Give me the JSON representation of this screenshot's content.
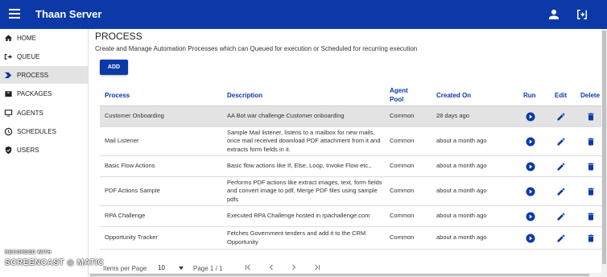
{
  "header": {
    "title": "Thaan Server",
    "user_icon": "person-icon",
    "logout_icon": "logout-icon"
  },
  "sidebar": {
    "items": [
      {
        "label": "HOME",
        "icon": "home-icon",
        "active": false
      },
      {
        "label": "QUEUE",
        "icon": "queue-icon",
        "active": false
      },
      {
        "label": "PROCESS",
        "icon": "process-icon",
        "active": true
      },
      {
        "label": "PACKAGES",
        "icon": "package-icon",
        "active": false
      },
      {
        "label": "AGENTS",
        "icon": "monitor-icon",
        "active": false
      },
      {
        "label": "SCHEDULES",
        "icon": "clock-icon",
        "active": false
      },
      {
        "label": "USERS",
        "icon": "shield-icon",
        "active": false
      }
    ]
  },
  "main": {
    "title": "PROCESS",
    "description": "Create and Manage Automation Processes which can Queued for execution or Scheduled for recurring execution",
    "add_label": "ADD"
  },
  "table": {
    "headers": {
      "process": "Process",
      "description": "Description",
      "agent_pool": "Agent Pool",
      "created_on": "Created On",
      "run": "Run",
      "edit": "Edit",
      "delete": "Delete"
    },
    "rows": [
      {
        "process": "Customer Onboarding",
        "description": "AA Bot war challenge Customer onboarding",
        "agent_pool": "Common",
        "created_on": "28 days ago"
      },
      {
        "process": "Mail Listener",
        "description": "Sample Mail listener, listens to a mailbox for new mails, once mail received download PDF attachment from it and extracts form fields in it.",
        "agent_pool": "Common",
        "created_on": "about a month ago"
      },
      {
        "process": "Basic Flow Actions",
        "description": "Basic flow actions like If, Else, Loop, Invoke Flow etc.,",
        "agent_pool": "Common",
        "created_on": "about a month ago"
      },
      {
        "process": "PDF Actions Sample",
        "description": "Performs PDF actions like extract images, text, form fields and convert image to pdf, Merge PDF files using sample pdfs",
        "agent_pool": "Common",
        "created_on": "about a month ago"
      },
      {
        "process": "RPA Challenge",
        "description": "Executed RPA Challenge hosted in rpachallenge.com",
        "agent_pool": "Common",
        "created_on": "about a month ago"
      },
      {
        "process": "Opportunity Tracker",
        "description": "Fetches Government tenders and add it to the CRM Opportunity",
        "agent_pool": "Common",
        "created_on": "about a month ago"
      }
    ]
  },
  "pagination": {
    "items_per_page_label": "Items per Page",
    "items_per_page": "10",
    "page_info": "Page 1 / 1"
  },
  "watermark": {
    "line1": "RECORDED WITH",
    "line2": "SCREENCAST ◎ MATIC"
  },
  "colors": {
    "primary": "#0b3aa8",
    "highlight_row": "#e3e3e3"
  }
}
